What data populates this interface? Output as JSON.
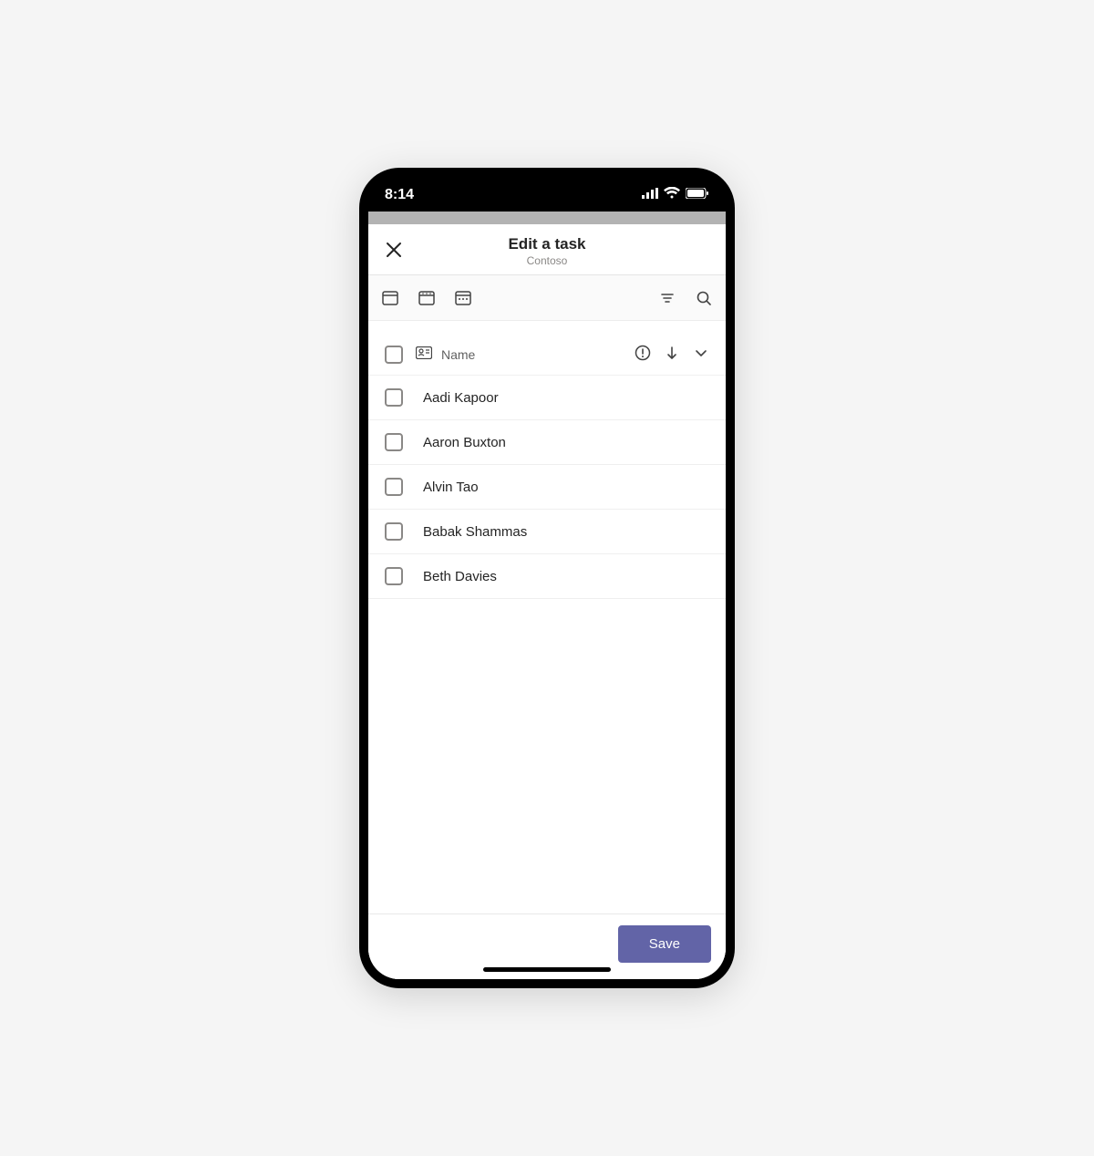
{
  "statusbar": {
    "time": "8:14"
  },
  "header": {
    "title": "Edit a task",
    "subtitle": "Contoso"
  },
  "listHeader": {
    "column_label": "Name"
  },
  "people": [
    {
      "name": "Aadi Kapoor"
    },
    {
      "name": "Aaron Buxton"
    },
    {
      "name": "Alvin Tao"
    },
    {
      "name": "Babak Shammas"
    },
    {
      "name": "Beth Davies"
    }
  ],
  "footer": {
    "save_label": "Save"
  }
}
